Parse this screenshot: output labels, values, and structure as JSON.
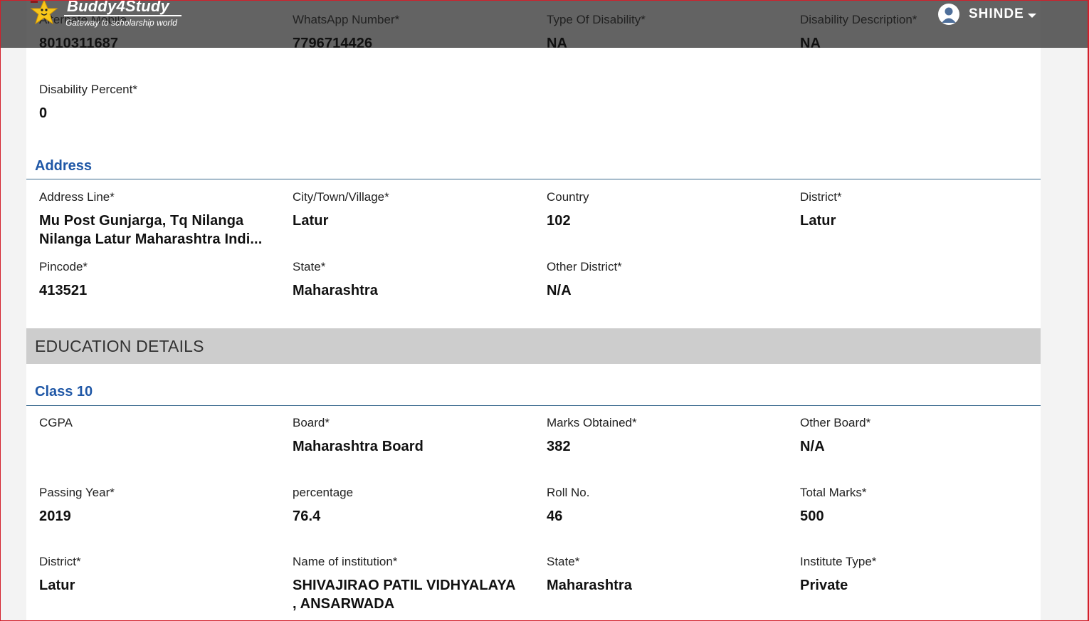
{
  "header": {
    "logo_text": "Buddy4Study",
    "logo_tagline": "Gateway to scholarship world",
    "user_name": "SHINDE"
  },
  "personal": {
    "alt_mobile": {
      "label": "Alternate Mobile",
      "value": "8010311687"
    },
    "whatsapp": {
      "label": "WhatsApp Number*",
      "value": "7796714426"
    },
    "disability_type": {
      "label": "Type Of Disability*",
      "value": "NA"
    },
    "disability_desc": {
      "label": "Disability Description*",
      "value": "NA"
    },
    "disability_percent": {
      "label": "Disability Percent*",
      "value": "0"
    }
  },
  "address": {
    "title": "Address",
    "line": {
      "label": "Address Line*",
      "value_1": "Mu Post Gunjarga, Tq Nilanga",
      "value_2": "Nilanga Latur Maharashtra Indi..."
    },
    "city": {
      "label": "City/Town/Village*",
      "value": "Latur"
    },
    "country": {
      "label": "Country",
      "value": "102"
    },
    "district": {
      "label": "District*",
      "value": "Latur"
    },
    "pincode": {
      "label": "Pincode*",
      "value": "413521"
    },
    "state": {
      "label": "State*",
      "value": "Maharashtra"
    },
    "other_district": {
      "label": "Other District*",
      "value": "N/A"
    }
  },
  "education": {
    "title": "EDUCATION DETAILS",
    "class10": {
      "title": "Class 10",
      "cgpa": {
        "label": "CGPA",
        "value": ""
      },
      "board": {
        "label": "Board*",
        "value": "Maharashtra Board"
      },
      "marks_obtained": {
        "label": "Marks Obtained*",
        "value": "382"
      },
      "other_board": {
        "label": "Other Board*",
        "value": "N/A"
      },
      "passing_year": {
        "label": "Passing Year*",
        "value": "2019"
      },
      "percentage": {
        "label": "percentage",
        "value": "76.4"
      },
      "roll_no": {
        "label": "Roll No.",
        "value": "46"
      },
      "total_marks": {
        "label": "Total Marks*",
        "value": "500"
      },
      "district": {
        "label": "District*",
        "value": "Latur"
      },
      "institution": {
        "label": "Name of institution*",
        "value_1": "SHIVAJIRAO PATIL VIDHYALAYA",
        "value_2": ", ANSARWADA"
      },
      "state": {
        "label": "State*",
        "value": "Maharashtra"
      },
      "institute_type": {
        "label": "Institute Type*",
        "value": "Private"
      }
    }
  }
}
